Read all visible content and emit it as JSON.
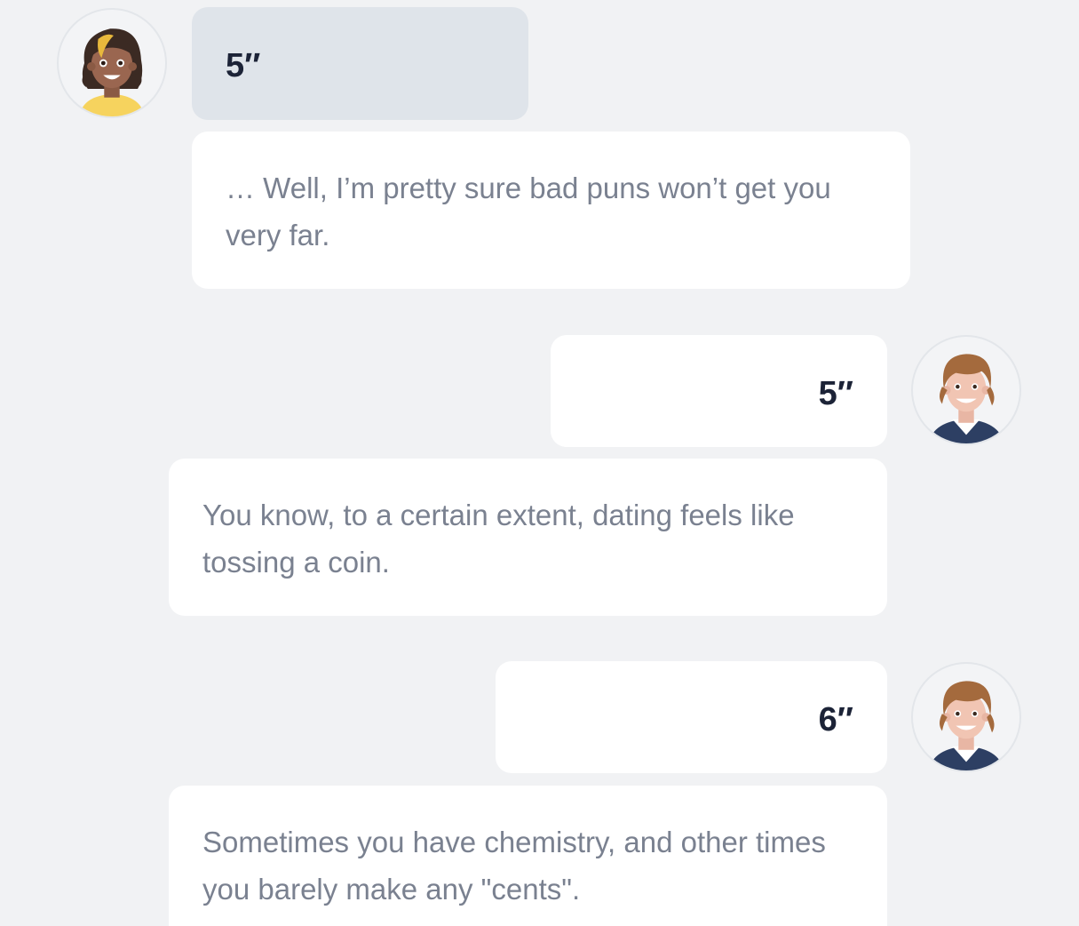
{
  "conversation": {
    "messages": [
      {
        "sender": "other",
        "kind": "selected-reply",
        "text": "5″"
      },
      {
        "sender": "other",
        "kind": "message",
        "text": "… Well, I’m pretty sure bad puns won’t get you very far."
      },
      {
        "sender": "self",
        "kind": "reply",
        "text": "5″"
      },
      {
        "sender": "other",
        "kind": "message",
        "text": "You know, to a certain extent, dating feels like tossing a coin."
      },
      {
        "sender": "self",
        "kind": "reply",
        "text": "6″"
      },
      {
        "sender": "other",
        "kind": "message",
        "text": "Sometimes you have chemistry, and other times you barely make any \"cents\"."
      }
    ]
  },
  "avatars": {
    "other": "woman-avatar-icon",
    "self": "man-avatar-icon"
  },
  "colors": {
    "background": "#f1f2f4",
    "selected_bubble": "#dfe4ea",
    "bubble": "#ffffff",
    "value_text": "#1c2337",
    "message_text": "#7a8190"
  }
}
